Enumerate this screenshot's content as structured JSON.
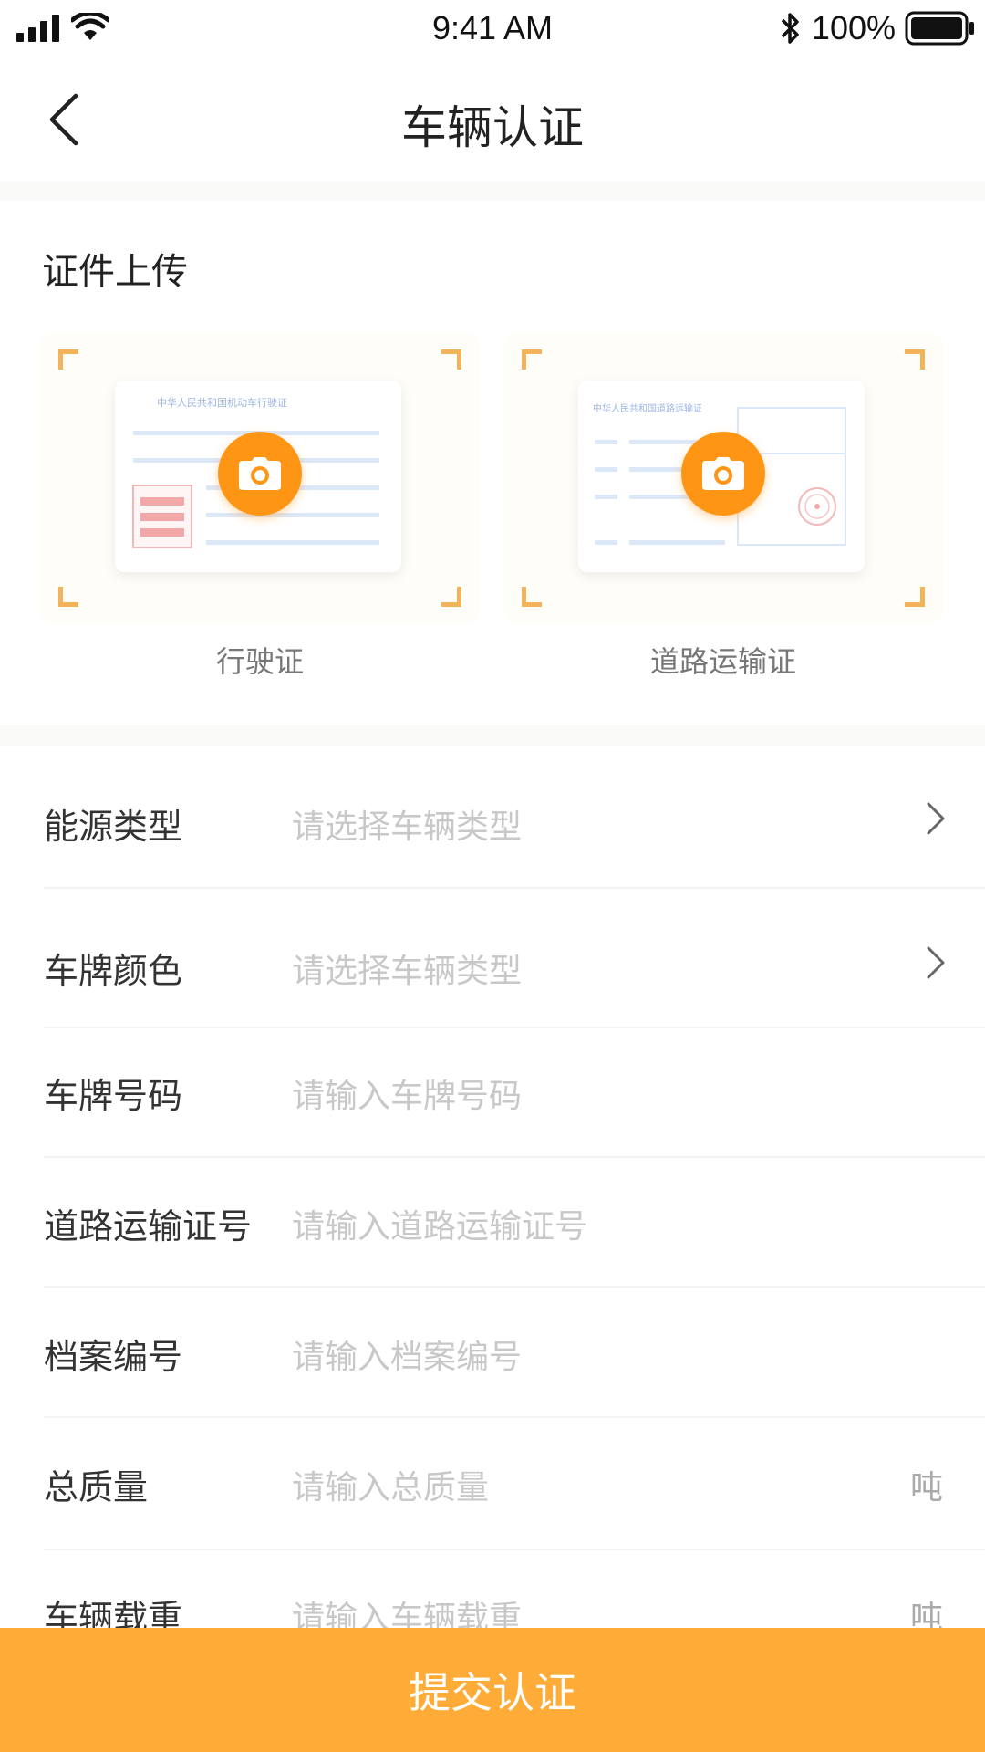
{
  "status_bar": {
    "time": "9:41 AM",
    "battery": "100%"
  },
  "nav": {
    "title": "车辆认证"
  },
  "upload": {
    "title": "证件上传",
    "cards": [
      {
        "label": "行驶证",
        "doc_header": "中华人民共和国机动车行驶证"
      },
      {
        "label": "道路运输证",
        "doc_header": "中华人民共和国道路运输证"
      }
    ]
  },
  "form": {
    "rows": [
      {
        "label": "能源类型",
        "placeholder": "请选择车辆类型"
      },
      {
        "label": "车牌颜色",
        "placeholder": "请选择车辆类型"
      },
      {
        "label": "车牌号码",
        "placeholder": "请输入车牌号码"
      },
      {
        "label": "道路运输证号",
        "placeholder": "请输入道路运输证号"
      },
      {
        "label": "档案编号",
        "placeholder": "请输入档案编号"
      },
      {
        "label": "总质量",
        "placeholder": "请输入总质量",
        "unit": "吨"
      },
      {
        "label": "车辆载重",
        "placeholder": "请输入车辆载重",
        "unit": "吨"
      }
    ]
  },
  "submit": {
    "label": "提交认证"
  },
  "colors": {
    "accent": "#ff9515",
    "submit": "#ffab38",
    "corner": "#f3b35a"
  },
  "icons": [
    "signal-icon",
    "wifi-icon",
    "bluetooth-icon",
    "battery-icon",
    "back-icon",
    "camera-icon",
    "chevron-right-icon"
  ]
}
